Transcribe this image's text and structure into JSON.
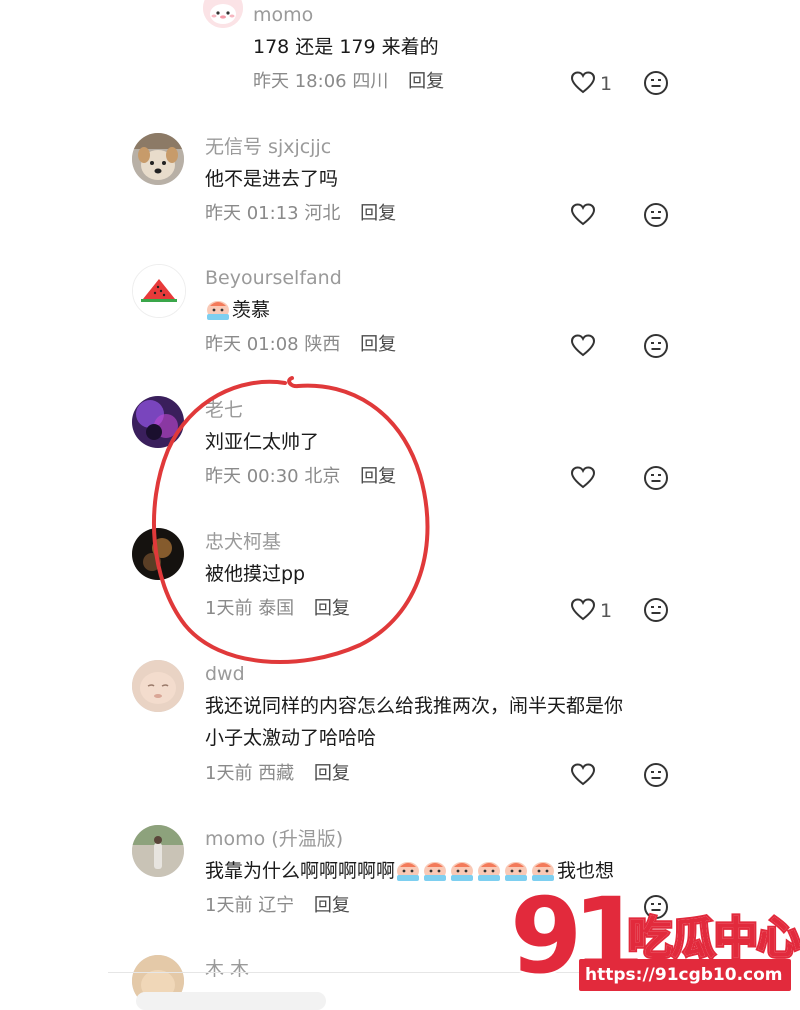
{
  "comments": [
    {
      "username": "momo",
      "text_lines": [
        "178 还是 179 来着的"
      ],
      "time": "昨天 18:06",
      "location": "四川",
      "reply_label": "回复",
      "like_count": "1",
      "avatar": "pink-cartoon-avatar"
    },
    {
      "username": "无信号 sjxjcjjc",
      "text_lines": [
        "他不是进去了吗"
      ],
      "time": "昨天 01:13",
      "location": "河北",
      "reply_label": "回复",
      "like_count": "",
      "avatar": "dog-photo-avatar"
    },
    {
      "username": "Beyourselfand",
      "text_prefix_emoji": "crying-face-emoji",
      "text_lines": [
        "羡慕"
      ],
      "time": "昨天 01:08",
      "location": "陕西",
      "reply_label": "回复",
      "like_count": "",
      "avatar": "watermelon-avatar"
    },
    {
      "username": "老七",
      "text_lines": [
        "刘亚仁太帅了"
      ],
      "time": "昨天 00:30",
      "location": "北京",
      "reply_label": "回复",
      "like_count": "",
      "avatar": "purple-photo-avatar"
    },
    {
      "username": "忠犬柯基",
      "text_lines": [
        "被他摸过pp"
      ],
      "time": "1天前",
      "location": "泰国",
      "reply_label": "回复",
      "like_count": "1",
      "avatar": "dark-photo-avatar"
    },
    {
      "username": "dwd",
      "text_lines": [
        "我还说同样的内容怎么给我推两次，闹半天都是你",
        "小子太激动了哈哈哈"
      ],
      "time": "1天前",
      "location": "西藏",
      "reply_label": "回复",
      "like_count": "",
      "avatar": "baby-photo-avatar"
    },
    {
      "username": "momo (升温版)",
      "text_before_emoji": "我靠为什么啊啊啊啊啊",
      "emoji_repeat": 6,
      "text_after_emoji": "我也想",
      "time": "1天前",
      "location": "辽宁",
      "reply_label": "回复",
      "like_count": "",
      "avatar": "person-photo-avatar"
    },
    {
      "username": "木 木",
      "avatar": "partial-avatar"
    }
  ],
  "watermark": {
    "number": "91",
    "text": "吃瓜中心",
    "url": "https://91cgb10.com"
  },
  "colors": {
    "annotation_circle": "#e0393a",
    "watermark": "#e22a3c",
    "username": "#9a9a9a",
    "meta": "#8a8a8a"
  }
}
